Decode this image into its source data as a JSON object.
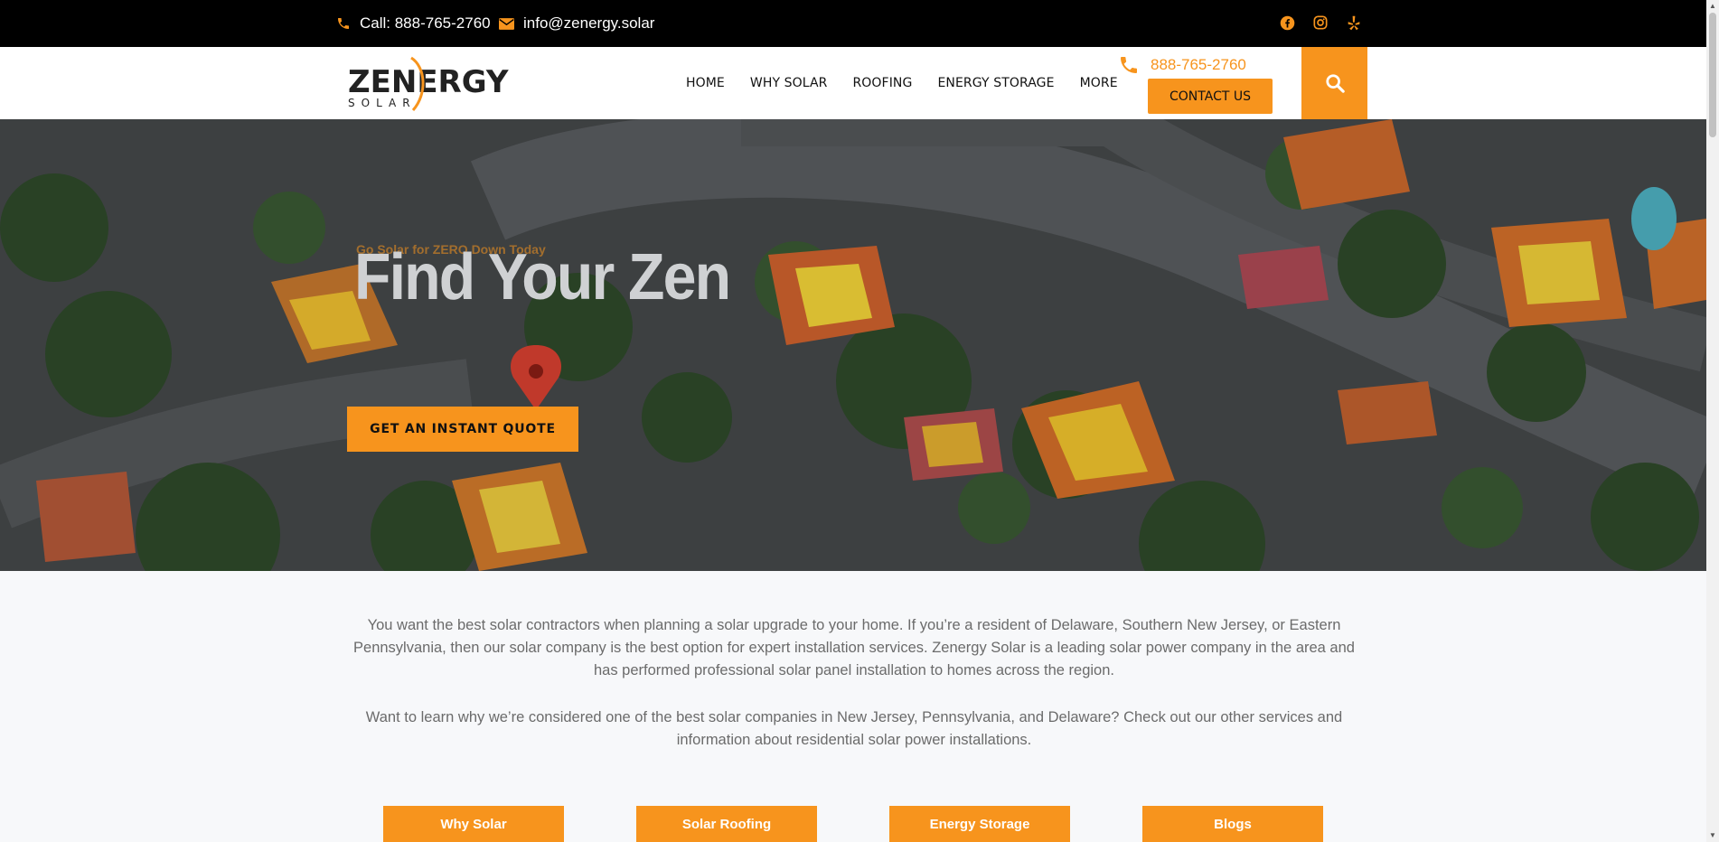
{
  "topbar": {
    "phone_label": "Call: 888-765-2760",
    "email_label": "info@zenergy.solar",
    "social_icons": [
      "facebook-icon",
      "instagram-icon",
      "yelp-icon"
    ]
  },
  "header": {
    "logo_text": "ZENERGY",
    "logo_subtext": "SOLAR",
    "nav": [
      "HOME",
      "WHY SOLAR",
      "ROOFING",
      "ENERGY STORAGE",
      "MORE"
    ],
    "phone": "888-765-2760",
    "contact_label": "CONTACT US"
  },
  "hero": {
    "eyebrow": "Go Solar for ZERO Down Today",
    "title": "Find Your Zen",
    "cta_label": "GET AN INSTANT QUOTE"
  },
  "intro": {
    "paragraph1": "You want the best solar contractors when planning a solar upgrade to your home. If you’re a resident of Delaware, Southern New Jersey, or Eastern Pennsylvania, then our solar company is the best option for expert installation services. Zenergy Solar is a leading solar power company in the area and has performed professional solar panel installation to homes across the region.",
    "paragraph2": "Want to learn why we’re considered one of the best solar companies in New Jersey, Pennsylvania, and Delaware? Check out our other services and information about residential solar power installations."
  },
  "links": [
    "Why Solar",
    "Solar Roofing",
    "Energy Storage",
    "Blogs"
  ],
  "colors": {
    "accent": "#f7941d",
    "topbar": "#000000",
    "page_bg": "#f7f8fa"
  }
}
